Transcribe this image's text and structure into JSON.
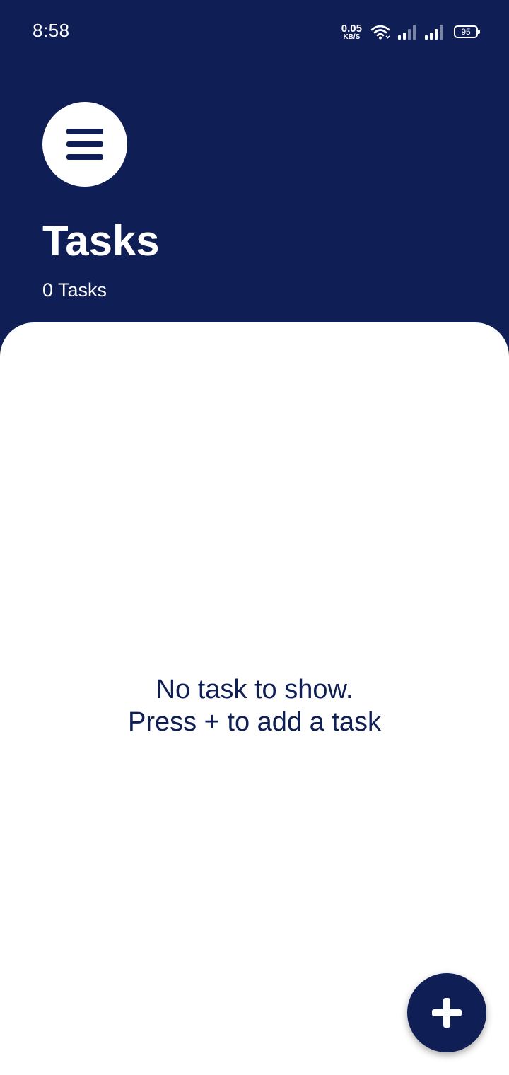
{
  "status_bar": {
    "time": "8:58",
    "net_speed_value": "0.05",
    "net_speed_unit": "KB/S",
    "battery_level": "95",
    "icons": [
      "wifi-icon",
      "signal-icon",
      "signal-icon",
      "battery-icon"
    ]
  },
  "header": {
    "menu_icon": "menu-icon",
    "title": "Tasks",
    "task_count": "0 Tasks"
  },
  "content": {
    "empty_line_1": "No task to show.",
    "empty_line_2": "Press + to add a task"
  },
  "fab": {
    "icon": "plus-icon"
  },
  "colors": {
    "primary": "#0f1f55",
    "surface": "#ffffff"
  }
}
